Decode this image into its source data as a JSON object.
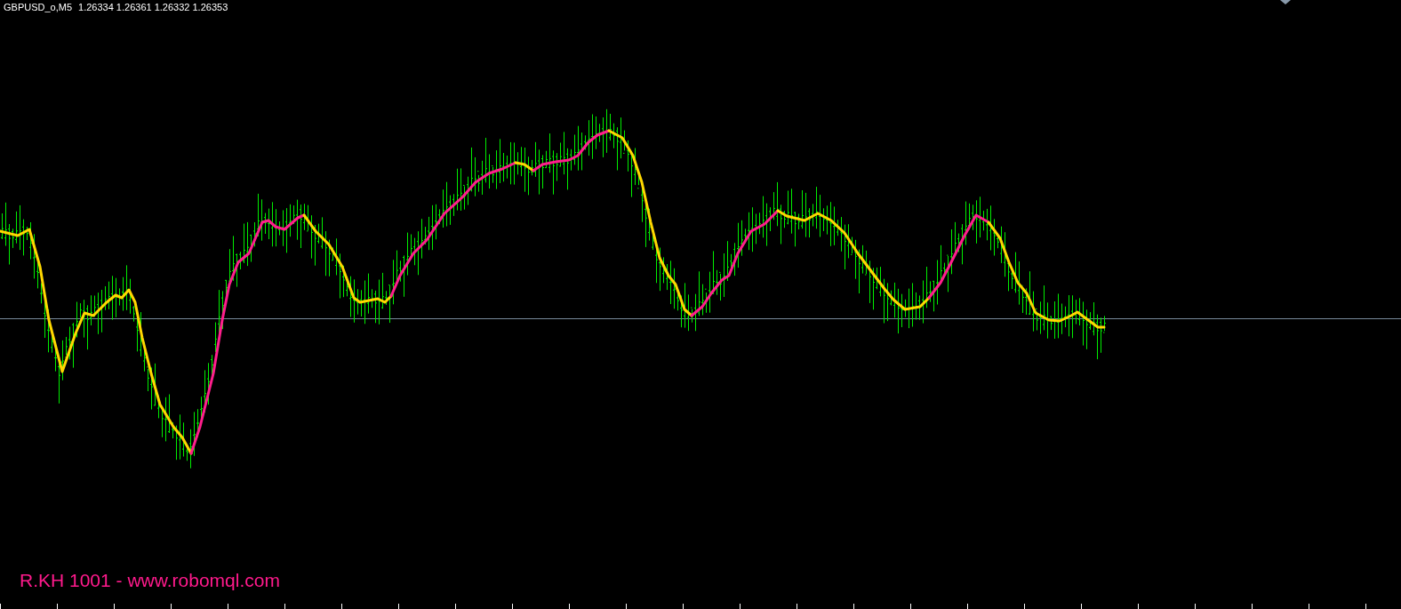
{
  "chart": {
    "symbol": "GBPUSD_o,M5",
    "quote": "1.26334 1.26361 1.26332 1.26353",
    "label": "R.KH 1001 - www.robomql.com"
  }
}
